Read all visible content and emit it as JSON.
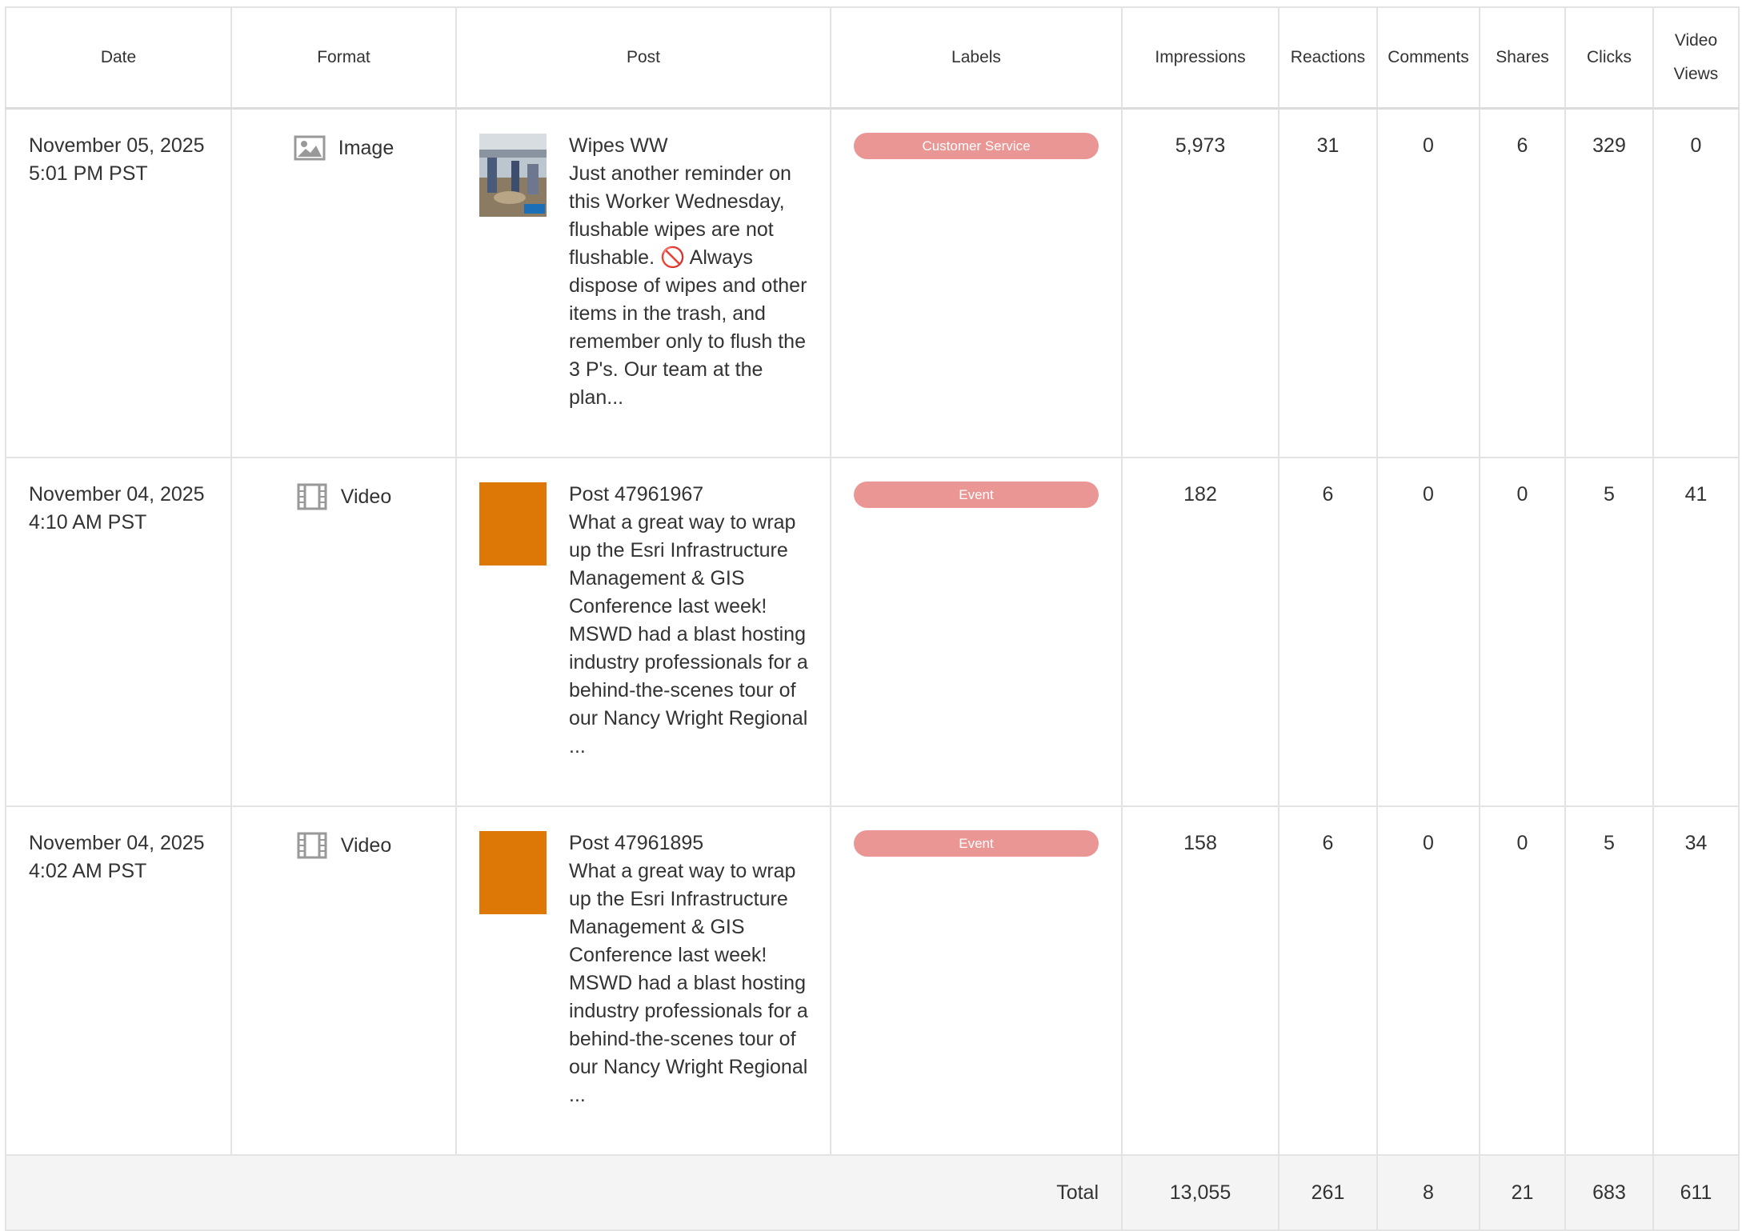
{
  "columns": [
    "Date",
    "Format",
    "Post",
    "Labels",
    "Impressions",
    "Reactions",
    "Comments",
    "Shares",
    "Clicks",
    "Video Views"
  ],
  "rows": [
    {
      "date": "November 05, 2025",
      "time": "5:01 PM PST",
      "format": "Image",
      "format_icon": "image-icon",
      "post_title": "Wipes WW",
      "post_body": "Just another reminder on this Worker Wednesday, flushable wipes are not flushable. 🚫 Always dispose of wipes and other items in the trash, and remember only to flush the 3 P's. Our team at the plan...",
      "label": "Customer Service",
      "impressions": "5,973",
      "reactions": "31",
      "comments": "0",
      "shares": "6",
      "clicks": "329",
      "video_views": "0"
    },
    {
      "date": "November 04, 2025",
      "time": "4:10 AM PST",
      "format": "Video",
      "format_icon": "film-icon",
      "post_title": "Post 47961967",
      "post_body": "What a great way to wrap up the Esri Infrastructure Management & GIS Conference last week! MSWD had a blast hosting industry professionals for a behind-the-scenes tour of our Nancy Wright Regional ...",
      "label": "Event",
      "impressions": "182",
      "reactions": "6",
      "comments": "0",
      "shares": "0",
      "clicks": "5",
      "video_views": "41"
    },
    {
      "date": "November 04, 2025",
      "time": "4:02 AM PST",
      "format": "Video",
      "format_icon": "film-icon",
      "post_title": "Post 47961895",
      "post_body": "What a great way to wrap up the Esri Infrastructure Management & GIS Conference last week! MSWD had a blast hosting industry professionals for a behind-the-scenes tour of our Nancy Wright Regional ...",
      "label": "Event",
      "impressions": "158",
      "reactions": "6",
      "comments": "0",
      "shares": "0",
      "clicks": "5",
      "video_views": "34"
    }
  ],
  "totals": {
    "label": "Total",
    "impressions": "13,055",
    "reactions": "261",
    "comments": "8",
    "shares": "21",
    "clicks": "683",
    "video_views": "611"
  },
  "colors": {
    "label_pill": "#ea9694",
    "video_thumb": "#dd7706",
    "total_bg": "#f4f4f4",
    "border": "#e3e3e3"
  }
}
